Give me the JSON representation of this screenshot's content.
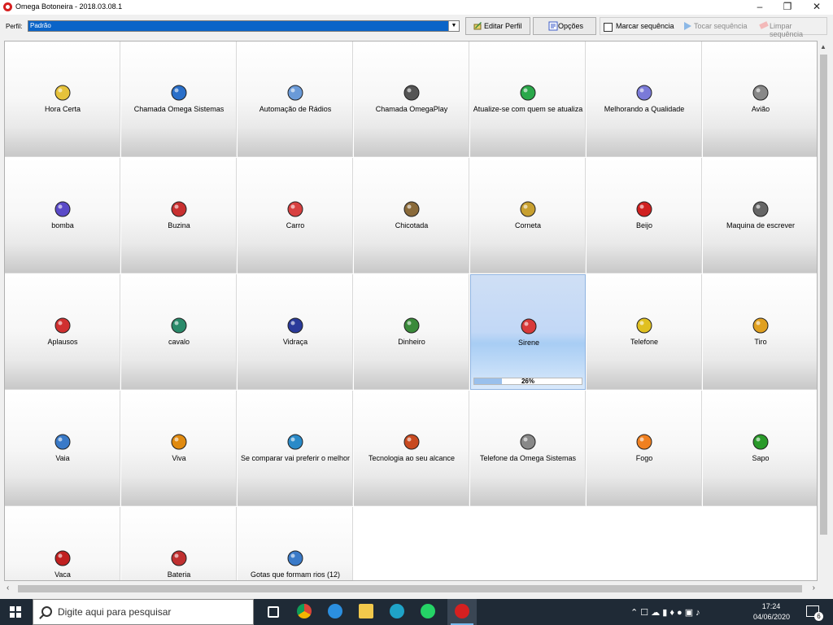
{
  "window": {
    "title": "Omega Botoneira - 2018.03.08.1"
  },
  "toolbar": {
    "profile_label": "Perfil:",
    "profile_value": "Padrão",
    "edit_profile": "Editar Perfil",
    "options": "Opções",
    "mark_sequence": "Marcar sequência",
    "play_sequence": "Tocar sequência",
    "clear_sequence": "Limpar sequência"
  },
  "tiles": [
    {
      "label": "Hora Certa",
      "icon": "clock-icon"
    },
    {
      "label": "Chamada Omega Sistemas",
      "icon": "globe-note-icon"
    },
    {
      "label": "Automação de Rádios",
      "icon": "radio-cd-icon"
    },
    {
      "label": "Chamada OmegaPlay",
      "icon": "speaker-note-icon"
    },
    {
      "label": "Atualize-se com quem se atualiza",
      "icon": "refresh-icon"
    },
    {
      "label": "Melhorando a Qualidade",
      "icon": "quality-disc-icon"
    },
    {
      "label": "Avião",
      "icon": "airplane-icon"
    },
    {
      "label": "bomba",
      "icon": "bomb-icon"
    },
    {
      "label": "Buzina",
      "icon": "horn-icon"
    },
    {
      "label": "Carro",
      "icon": "car-icon"
    },
    {
      "label": "Chicotada",
      "icon": "whip-icon"
    },
    {
      "label": "Corneta",
      "icon": "trumpet-icon"
    },
    {
      "label": "Beijo",
      "icon": "lips-icon"
    },
    {
      "label": "Maquina de escrever",
      "icon": "typewriter-icon"
    },
    {
      "label": "Aplausos",
      "icon": "hand-icon"
    },
    {
      "label": "cavalo",
      "icon": "horse-icon"
    },
    {
      "label": "Vidraça",
      "icon": "window-icon"
    },
    {
      "label": "Dinheiro",
      "icon": "money-icon"
    },
    {
      "label": "Sirene",
      "icon": "siren-icon",
      "progress": 0.26,
      "progress_text": "26%"
    },
    {
      "label": "Telefone",
      "icon": "phone-icon"
    },
    {
      "label": "Tiro",
      "icon": "gun-icon"
    },
    {
      "label": "Vaia",
      "icon": "boo-face-icon"
    },
    {
      "label": "Viva",
      "icon": "smile-icon"
    },
    {
      "label": "Se comparar vai preferir o melhor",
      "icon": "compare-icon"
    },
    {
      "label": "Tecnologia ao seu alcance",
      "icon": "tech-icon"
    },
    {
      "label": "Telefone da Omega Sistemas",
      "icon": "fax-icon"
    },
    {
      "label": "Fogo",
      "icon": "fire-icon"
    },
    {
      "label": "Sapo",
      "icon": "frog-icon"
    },
    {
      "label": "Vaca",
      "icon": "bull-icon"
    },
    {
      "label": "Bateria",
      "icon": "drums-icon"
    },
    {
      "label": "Gotas que formam rios (12)",
      "icon": "drops-icon"
    }
  ],
  "taskbar": {
    "search_placeholder": "Digite aqui para pesquisar",
    "time": "17:24",
    "date": "04/06/2020",
    "notifications": "6"
  },
  "colors": {
    "accent": "#0a64c8",
    "active_tile": "#a8cdf4",
    "taskbar": "#1f2a36"
  }
}
